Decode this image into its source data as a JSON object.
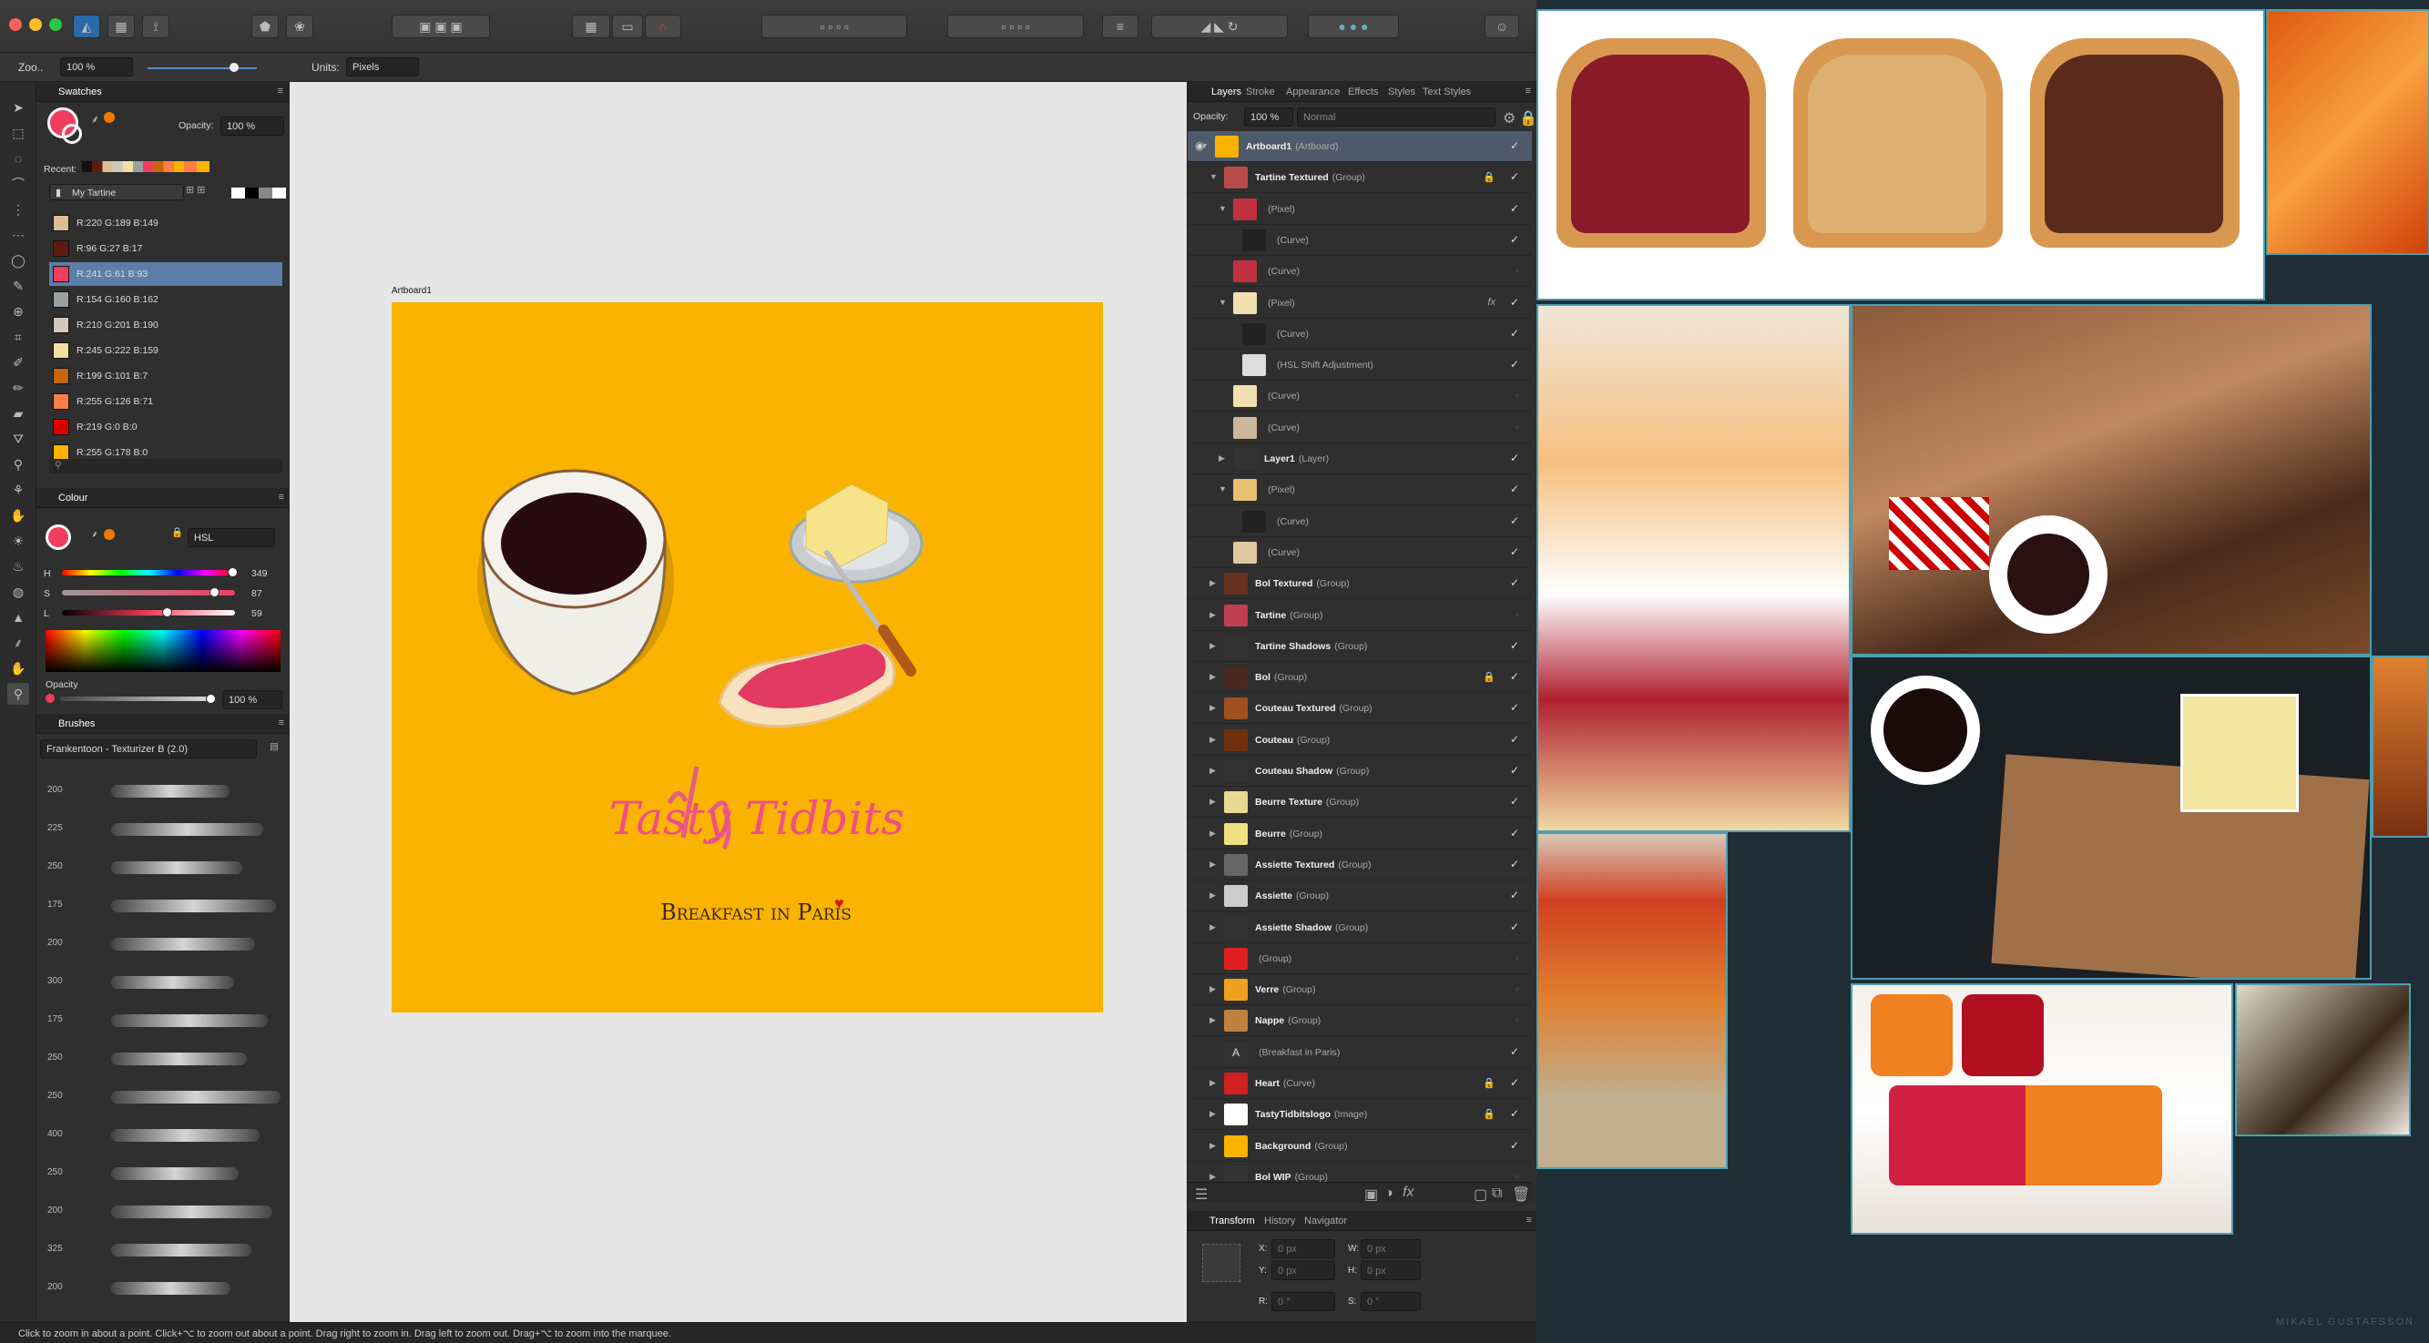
{
  "toolbar": {
    "buttons": [
      "persona-icon",
      "pixel-persona-icon",
      "export-persona-icon",
      "snapping-icon",
      "transform-icon",
      "arrange-icon",
      "align-icon",
      "boolean-icon",
      "view-icon",
      "user-icon"
    ]
  },
  "context": {
    "zoom_label": "Zoo..",
    "zoom_value": "100 %",
    "units_label": "Units:",
    "units_value": "Pixels"
  },
  "swatches": {
    "tab": "Swatches",
    "opacity_label": "Opacity:",
    "opacity_value": "100 %",
    "recent_label": "Recent:",
    "palette": "My Tartine",
    "items": [
      {
        "label": "R:220 G:189 B:149",
        "color": "#dcbd95"
      },
      {
        "label": "R:96 G:27 B:17",
        "color": "#601b11"
      },
      {
        "label": "R:241 G:61 B:93",
        "color": "#f13d5d"
      },
      {
        "label": "R:154 G:160 B:162",
        "color": "#9aa0a2"
      },
      {
        "label": "R:210 G:201 B:190",
        "color": "#d2c9be"
      },
      {
        "label": "R:245 G:222 B:159",
        "color": "#f5de9f"
      },
      {
        "label": "R:199 G:101 B:7",
        "color": "#c76507"
      },
      {
        "label": "R:255 G:126 B:71",
        "color": "#ff7e47"
      },
      {
        "label": "R:219 G:0 B:0",
        "color": "#db0000"
      },
      {
        "label": "R:255 G:178 B:0",
        "color": "#ffb200"
      }
    ],
    "selected": 2
  },
  "colour": {
    "tab": "Colour",
    "model": "HSL",
    "h_label": "H",
    "h_value": "349",
    "s_label": "S",
    "s_value": "87",
    "l_label": "L",
    "l_value": "59",
    "opacity_label": "Opacity",
    "opacity_value": "100 %"
  },
  "brushes": {
    "tab": "Brushes",
    "category": "Frankentoon - Texturizer B (2.0)",
    "sizes": [
      "200",
      "225",
      "250",
      "175",
      "200",
      "300",
      "175",
      "250",
      "250",
      "400",
      "250",
      "200",
      "325",
      "200"
    ]
  },
  "artboard": {
    "name": "Artboard1",
    "logo_text": "Tasty Tidbits",
    "subtitle": "Breakfast in Paris"
  },
  "layers_panel": {
    "tabs": [
      "Layers",
      "Stroke",
      "Appearance",
      "Effects",
      "Styles",
      "Text Styles"
    ],
    "opacity_label": "Opacity:",
    "opacity_value": "100 %",
    "blend": "Normal",
    "rows": [
      {
        "name": "Artboard1",
        "type": "(Artboard)",
        "indent": 0,
        "thumb": "#f9b300",
        "check": true,
        "lock": false,
        "selected": true
      },
      {
        "name": "Tartine Textured",
        "type": "(Group)",
        "indent": 1,
        "thumb": "#b84a4a",
        "check": true,
        "lock": true
      },
      {
        "name": "",
        "type": "(Pixel)",
        "indent": 2,
        "thumb": "#c03040",
        "check": true,
        "lock": false
      },
      {
        "name": "",
        "type": "(Curve)",
        "indent": 3,
        "thumb": "#222",
        "check": true,
        "lock": false
      },
      {
        "name": "",
        "type": "(Curve)",
        "indent": 2,
        "thumb": "#c03040",
        "check": false,
        "lock": false
      },
      {
        "name": "",
        "type": "(Pixel)",
        "indent": 2,
        "thumb": "#f0e0b0",
        "check": true,
        "lock": false,
        "fx": true
      },
      {
        "name": "",
        "type": "(Curve)",
        "indent": 3,
        "thumb": "#222",
        "check": true,
        "lock": false
      },
      {
        "name": "",
        "type": "(HSL Shift Adjustment)",
        "indent": 3,
        "thumb": "#ddd",
        "check": true,
        "lock": false
      },
      {
        "name": "",
        "type": "(Curve)",
        "indent": 2,
        "thumb": "#f0e0b0",
        "check": false,
        "lock": false
      },
      {
        "name": "",
        "type": "(Curve)",
        "indent": 2,
        "thumb": "#cbb89a",
        "check": false,
        "lock": false
      },
      {
        "name": "Layer1",
        "type": "(Layer)",
        "indent": 2,
        "thumb": "#333",
        "check": true,
        "lock": false
      },
      {
        "name": "",
        "type": "(Pixel)",
        "indent": 2,
        "thumb": "#e8c070",
        "check": true,
        "lock": false
      },
      {
        "name": "",
        "type": "(Curve)",
        "indent": 3,
        "thumb": "#222",
        "check": true,
        "lock": false
      },
      {
        "name": "",
        "type": "(Curve)",
        "indent": 2,
        "thumb": "#e0c8a0",
        "check": true,
        "lock": false
      },
      {
        "name": "Bol Textured",
        "type": "(Group)",
        "indent": 1,
        "thumb": "#6a3020",
        "check": true,
        "lock": false
      },
      {
        "name": "Tartine",
        "type": "(Group)",
        "indent": 1,
        "thumb": "#c04050",
        "check": false,
        "lock": false
      },
      {
        "name": "Tartine Shadows",
        "type": "(Group)",
        "indent": 1,
        "thumb": "#333",
        "check": true,
        "lock": false
      },
      {
        "name": "Bol",
        "type": "(Group)",
        "indent": 1,
        "thumb": "#4a2a20",
        "check": true,
        "lock": true
      },
      {
        "name": "Couteau Textured",
        "type": "(Group)",
        "indent": 1,
        "thumb": "#a05020",
        "check": true,
        "lock": false
      },
      {
        "name": "Couteau",
        "type": "(Group)",
        "indent": 1,
        "thumb": "#703010",
        "check": true,
        "lock": false
      },
      {
        "name": "Couteau Shadow",
        "type": "(Group)",
        "indent": 1,
        "thumb": "#333",
        "check": true,
        "lock": false
      },
      {
        "name": "Beurre Texture",
        "type": "(Group)",
        "indent": 1,
        "thumb": "#e8d890",
        "check": true,
        "lock": false
      },
      {
        "name": "Beurre",
        "type": "(Group)",
        "indent": 1,
        "thumb": "#f0e080",
        "check": true,
        "lock": false
      },
      {
        "name": "Assiette Textured",
        "type": "(Group)",
        "indent": 1,
        "thumb": "#666",
        "check": true,
        "lock": false
      },
      {
        "name": "Assiette",
        "type": "(Group)",
        "indent": 1,
        "thumb": "#ccc",
        "check": true,
        "lock": false
      },
      {
        "name": "Assiette Shadow",
        "type": "(Group)",
        "indent": 1,
        "thumb": "#333",
        "check": true,
        "lock": false
      },
      {
        "name": "",
        "type": "(Group)",
        "indent": 1,
        "thumb": "#e02020",
        "check": false,
        "lock": false
      },
      {
        "name": "Verre",
        "type": "(Group)",
        "indent": 1,
        "thumb": "#f0a020",
        "check": false,
        "lock": false
      },
      {
        "name": "Nappe",
        "type": "(Group)",
        "indent": 1,
        "thumb": "#c08040",
        "check": false,
        "lock": false
      },
      {
        "name": "",
        "type": "(Breakfast in Paris)",
        "indent": 1,
        "thumb": "#333",
        "check": true,
        "lock": false,
        "text": true
      },
      {
        "name": "Heart",
        "type": "(Curve)",
        "indent": 1,
        "thumb": "#d02020",
        "check": true,
        "lock": true
      },
      {
        "name": "TastyTidbitslogo",
        "type": "(Image)",
        "indent": 1,
        "thumb": "#fff",
        "check": true,
        "lock": true
      },
      {
        "name": "Background",
        "type": "(Group)",
        "indent": 1,
        "thumb": "#f9b300",
        "check": true,
        "lock": false
      },
      {
        "name": "Bol WIP",
        "type": "(Group)",
        "indent": 1,
        "thumb": "#333",
        "check": false,
        "lock": false
      }
    ]
  },
  "transform_panel": {
    "tabs": [
      "Transform",
      "History",
      "Navigator"
    ],
    "x_label": "X:",
    "x_value": "0 px",
    "y_label": "Y:",
    "y_value": "0 px",
    "w_label": "W:",
    "w_value": "0 px",
    "h_label": "H:",
    "h_value": "0 px",
    "r_label": "R:",
    "r_value": "0 °",
    "s_label": "S:",
    "s_value": "0 °"
  },
  "status": {
    "text": "Click to zoom in about a point. Click+⌥ to zoom out about a point. Drag right to zoom in. Drag left to zoom out. Drag+⌥ to zoom into the marquee."
  },
  "refboard": {
    "watermark": "MIKAEL GUSTAFSSON",
    "tiles": [
      "jam-toast-photo",
      "peanut-butter-toast-photo",
      "chocolate-toast-photo",
      "orange-jam-photo",
      "breakfast-table-photo",
      "french-breakfast-photo",
      "jam-jars-photo",
      "baguette-breakfast-photo",
      "apricot-jar-photo",
      "jam-toast-plate-photo",
      "coffee-bread-photo"
    ]
  }
}
